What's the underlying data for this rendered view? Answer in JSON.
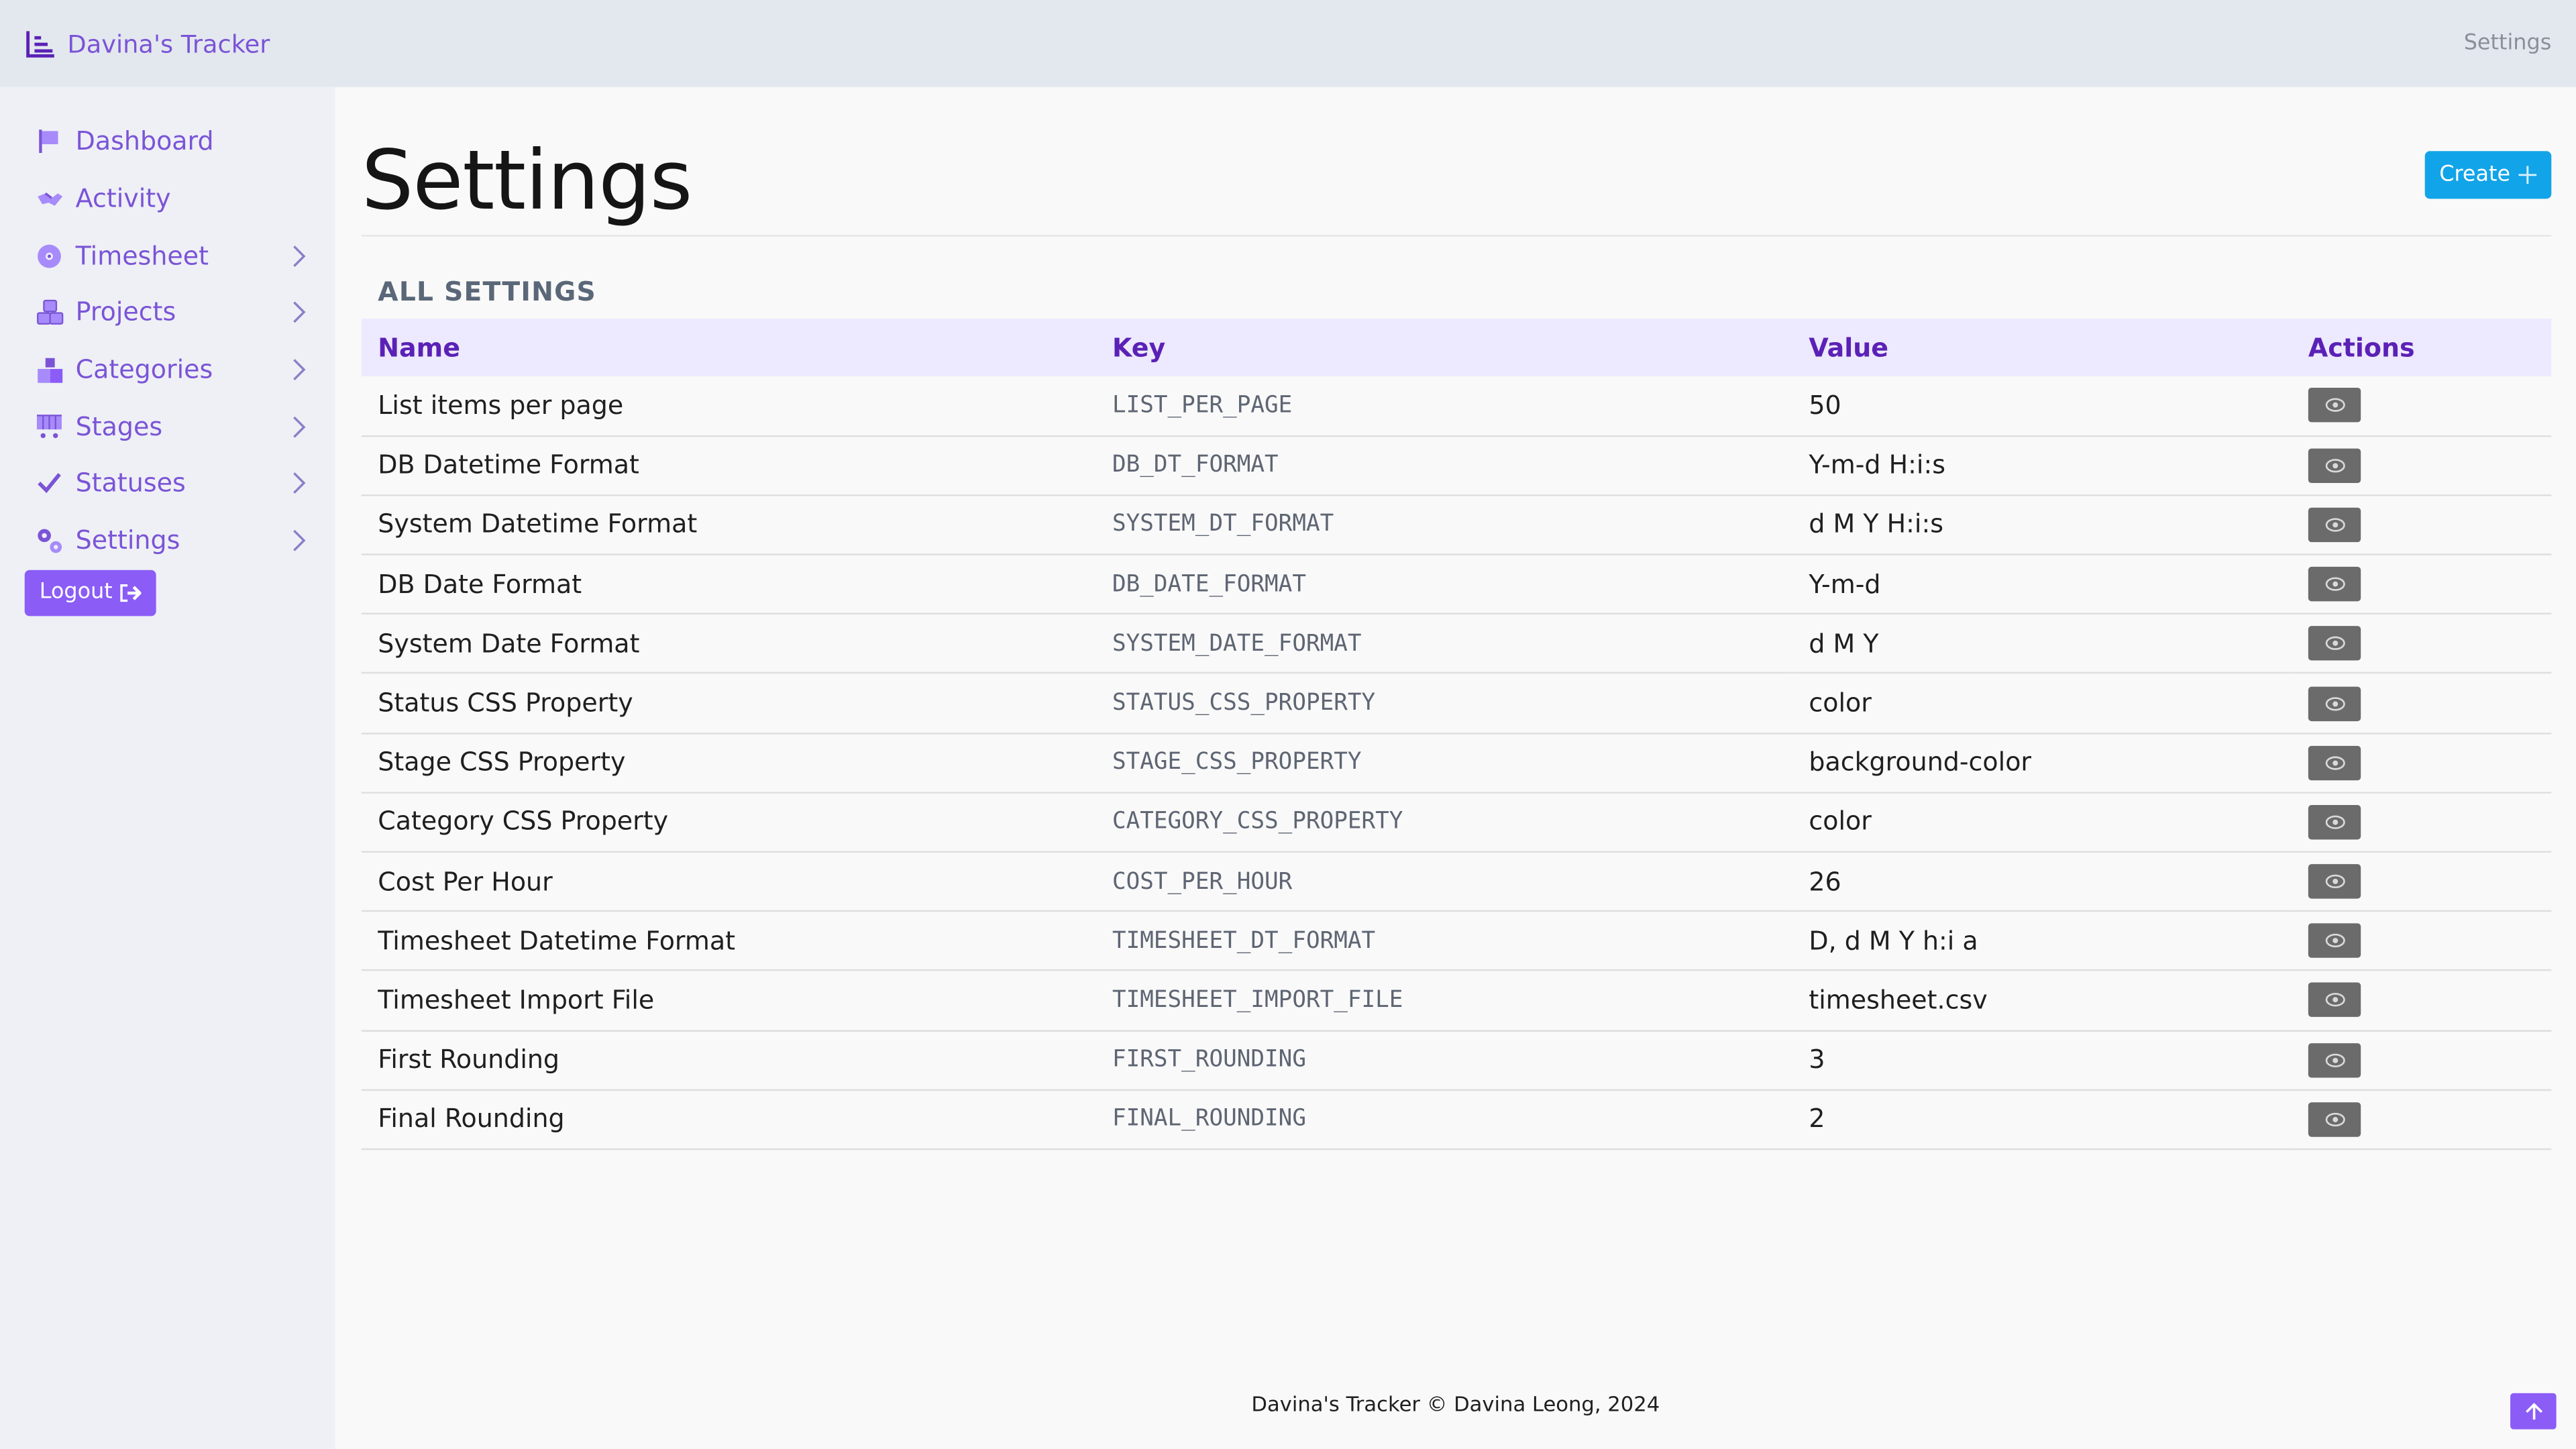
{
  "app": {
    "brand": "Davina's Tracker",
    "top_right": "Settings"
  },
  "sidebar": {
    "items": [
      {
        "label": "Dashboard",
        "icon": "flag-icon",
        "has_chevron": false
      },
      {
        "label": "Activity",
        "icon": "handshake-icon",
        "has_chevron": false
      },
      {
        "label": "Timesheet",
        "icon": "disc-icon",
        "has_chevron": true
      },
      {
        "label": "Projects",
        "icon": "cubes-icon",
        "has_chevron": true
      },
      {
        "label": "Categories",
        "icon": "boxes-icon",
        "has_chevron": true
      },
      {
        "label": "Stages",
        "icon": "cart-icon",
        "has_chevron": true
      },
      {
        "label": "Statuses",
        "icon": "check-icon",
        "has_chevron": true
      },
      {
        "label": "Settings",
        "icon": "gears-icon",
        "has_chevron": true
      }
    ],
    "logout_label": "Logout"
  },
  "main": {
    "title": "Settings",
    "create_label": "Create",
    "section_title": "ALL SETTINGS",
    "table": {
      "headers": [
        "Name",
        "Key",
        "Value",
        "Actions"
      ],
      "rows": [
        {
          "name": "List items per page",
          "key": "LIST_PER_PAGE",
          "value": "50"
        },
        {
          "name": "DB Datetime Format",
          "key": "DB_DT_FORMAT",
          "value": "Y-m-d H:i:s"
        },
        {
          "name": "System Datetime Format",
          "key": "SYSTEM_DT_FORMAT",
          "value": "d M Y H:i:s"
        },
        {
          "name": "DB Date Format",
          "key": "DB_DATE_FORMAT",
          "value": "Y-m-d"
        },
        {
          "name": "System Date Format",
          "key": "SYSTEM_DATE_FORMAT",
          "value": "d M Y"
        },
        {
          "name": "Status CSS Property",
          "key": "STATUS_CSS_PROPERTY",
          "value": "color"
        },
        {
          "name": "Stage CSS Property",
          "key": "STAGE_CSS_PROPERTY",
          "value": "background-color"
        },
        {
          "name": "Category CSS Property",
          "key": "CATEGORY_CSS_PROPERTY",
          "value": "color"
        },
        {
          "name": "Cost Per Hour",
          "key": "COST_PER_HOUR",
          "value": "26"
        },
        {
          "name": "Timesheet Datetime Format",
          "key": "TIMESHEET_DT_FORMAT",
          "value": "D, d M Y h:i a"
        },
        {
          "name": "Timesheet Import File",
          "key": "TIMESHEET_IMPORT_FILE",
          "value": "timesheet.csv"
        },
        {
          "name": "First Rounding",
          "key": "FIRST_ROUNDING",
          "value": "3"
        },
        {
          "name": "Final Rounding",
          "key": "FINAL_ROUNDING",
          "value": "2"
        }
      ]
    }
  },
  "footer": {
    "text": "Davina's Tracker © Davina Leong, 2024"
  },
  "colors": {
    "accent": "#7b54d6",
    "primary_button": "#12a4e8",
    "logout_button": "#8b5cf6",
    "header_row": "#ede9fe",
    "view_button": "#6b6b6b"
  }
}
